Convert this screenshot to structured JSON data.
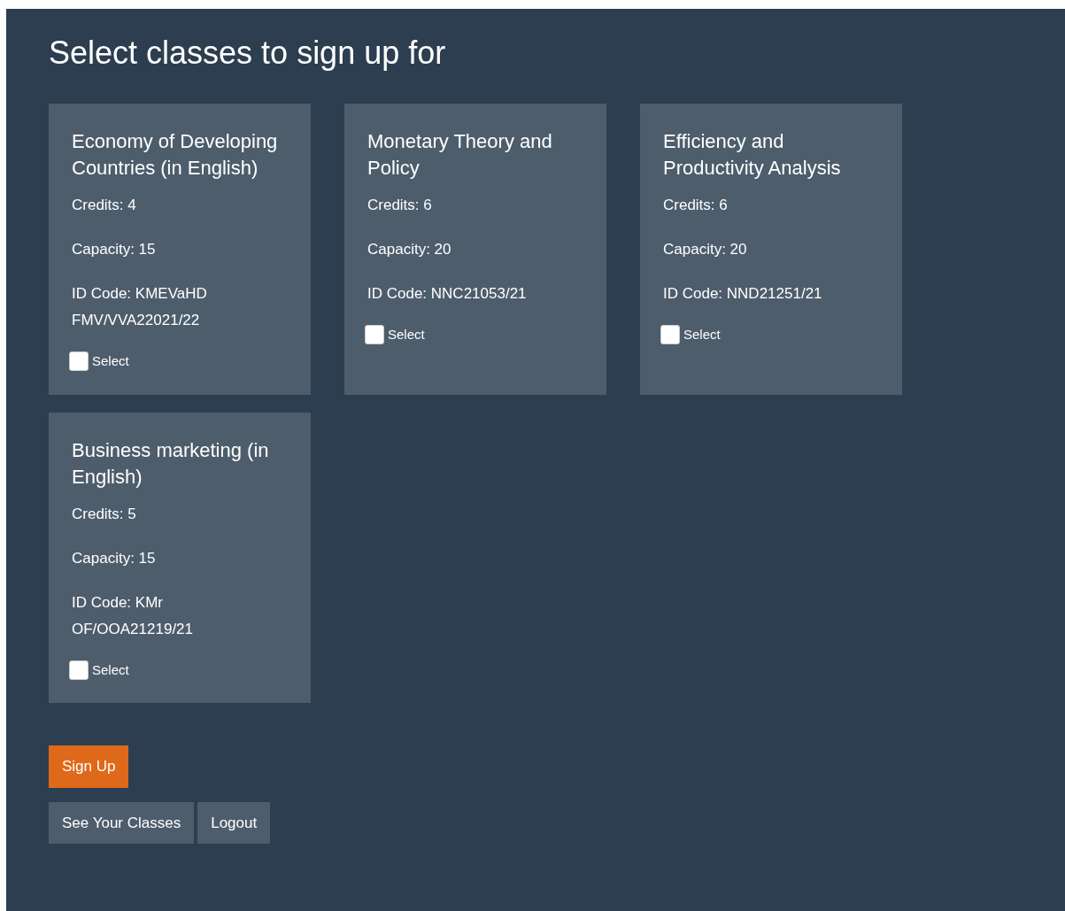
{
  "title": "Select classes to sign up for",
  "classes": [
    {
      "name": "Economy of Developing Countries (in English)",
      "credits": "Credits: 4",
      "capacity": "Capacity: 15",
      "id_code": "ID Code: KMEVaHD FMV/VVA22021/22",
      "select_label": "Select",
      "selected": false
    },
    {
      "name": "Monetary Theory and Policy",
      "credits": "Credits: 6",
      "capacity": "Capacity: 20",
      "id_code": "ID Code: NNC21053/21",
      "select_label": "Select",
      "selected": false
    },
    {
      "name": "Efficiency and Productivity Analysis",
      "credits": "Credits: 6",
      "capacity": "Capacity: 20",
      "id_code": "ID Code: NND21251/21",
      "select_label": "Select",
      "selected": false
    },
    {
      "name": "Business marketing (in English)",
      "credits": "Credits: 5",
      "capacity": "Capacity: 15",
      "id_code": "ID Code: KMr OF/OOA21219/21",
      "select_label": "Select",
      "selected": false
    }
  ],
  "sign_up_button": "Sign Up",
  "nav_buttons": [
    "See Your Classes",
    "Logout"
  ]
}
